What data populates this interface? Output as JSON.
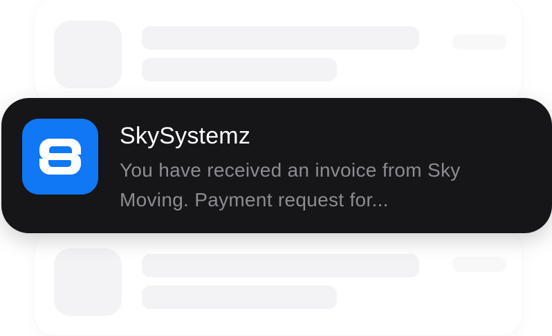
{
  "notification": {
    "app_name": "SkySystemz",
    "message": "You have received an invoice from Sky Moving. Payment request for...",
    "app_icon": "skysystemz-logo-icon",
    "icon_color": "#1077f5",
    "background_color": "#161518"
  }
}
